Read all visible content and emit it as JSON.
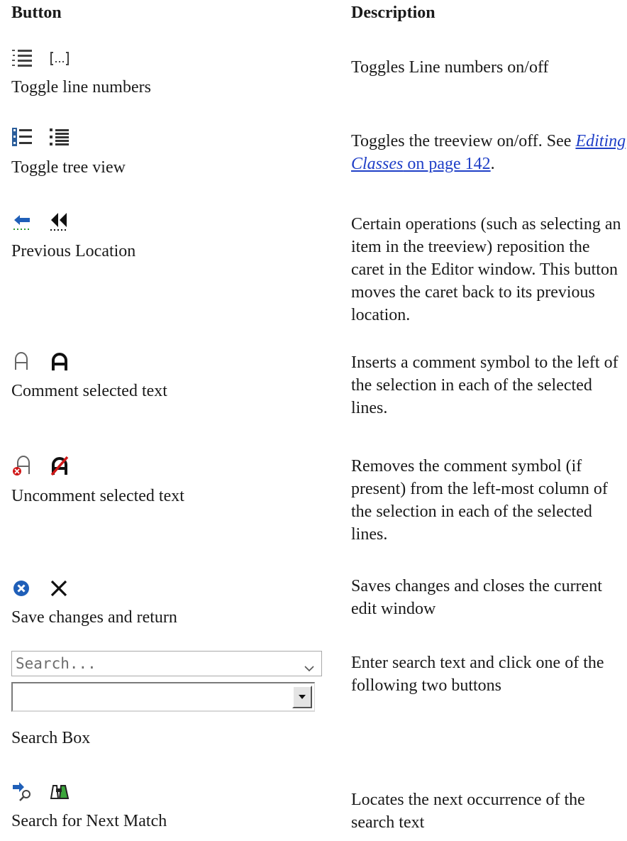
{
  "headers": {
    "button": "Button",
    "description": "Description"
  },
  "rows": [
    {
      "label": "Toggle line numbers",
      "icons": [
        "line-numbers-icon",
        "bracket-ellipsis-icon"
      ],
      "desc": "Toggles Line numbers on/off"
    },
    {
      "label": "Toggle tree view",
      "icons": [
        "tree-view-icon",
        "tree-view-alt-icon"
      ],
      "desc_pre": "Toggles the treeview on/off. See ",
      "link_italic": "Editing Classes",
      "link_rest": " on page 142",
      "desc_post": "."
    },
    {
      "label": "Previous Location",
      "icons": [
        "back-arrow-icon",
        "rewind-icon"
      ],
      "desc": "Certain operations (such as selecting an item in the treeview) reposition the caret in the Editor window. This button moves the caret back to its previous location."
    },
    {
      "label": "Comment selected text",
      "icons": [
        "comment-outline-icon",
        "comment-bold-icon"
      ],
      "desc": "Inserts a comment symbol to the left of the selection in each of the selected lines."
    },
    {
      "label": "Uncomment selected text",
      "icons": [
        "uncomment-outline-icon",
        "uncomment-bold-icon"
      ],
      "desc": "Removes the comment symbol (if present) from the left-most column of the selection in each of the selected lines."
    },
    {
      "label": "Save changes and return",
      "icons": [
        "close-circle-icon",
        "close-x-icon"
      ],
      "desc": "Saves changes and closes the current edit window"
    },
    {
      "label": "Search Box",
      "search_placeholder": "Search...",
      "desc": "Enter search text and click one of the following two buttons"
    },
    {
      "label": "Search for Next Match",
      "icons": [
        "find-next-icon",
        "binoculars-icon"
      ],
      "desc": "Locates the next occurrence of the search text"
    }
  ],
  "colors": {
    "link": "#1f3fc7",
    "accent_blue": "#1f5fb8",
    "accent_red": "#d01818",
    "accent_green": "#2e9a2e"
  }
}
